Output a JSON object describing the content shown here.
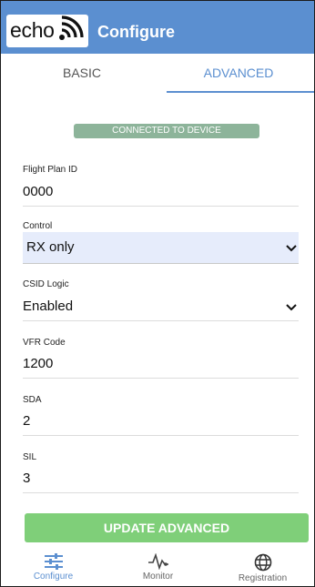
{
  "app": {
    "logo_text": "echo",
    "title": "Configure",
    "colors": {
      "primary": "#5b8fd0",
      "status": "#8db49a",
      "update_button": "#7fcf79"
    }
  },
  "tabs": [
    {
      "label": "BASIC",
      "active": false
    },
    {
      "label": "ADVANCED",
      "active": true
    }
  ],
  "status_badge": "CONNECTED TO DEVICE",
  "fields": {
    "flight_plan_id": {
      "label": "Flight Plan ID",
      "value": "0000"
    },
    "control": {
      "label": "Control",
      "value": "RX only"
    },
    "csid_logic": {
      "label": "CSID Logic",
      "value": "Enabled"
    },
    "vfr_code": {
      "label": "VFR Code",
      "value": "1200"
    },
    "sda": {
      "label": "SDA",
      "value": "2"
    },
    "sil": {
      "label": "SIL",
      "value": "3"
    }
  },
  "update_button": "UPDATE ADVANCED",
  "bottom_nav": [
    {
      "label": "Configure",
      "icon": "sliders-icon",
      "active": true
    },
    {
      "label": "Monitor",
      "icon": "pulse-icon",
      "active": false
    },
    {
      "label": "Registration",
      "icon": "globe-icon",
      "active": false
    }
  ]
}
